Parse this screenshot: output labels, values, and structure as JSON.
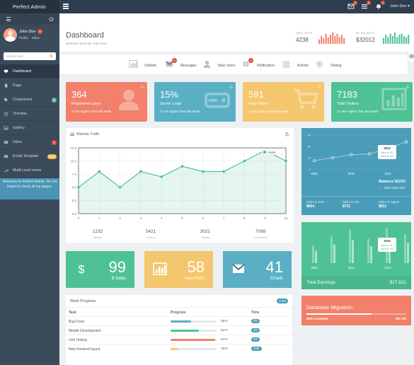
{
  "topbar": {
    "brand": "Perfect Admin",
    "badges": {
      "messages": "4",
      "tasks": "5",
      "notifications": "1"
    },
    "user": "John Doe"
  },
  "sidebar": {
    "profile": {
      "name": "John Doe",
      "badge": "4",
      "link_profile": "Profile",
      "link_inbox": "Inbox"
    },
    "search_placeholder": "search here...",
    "items": [
      {
        "label": "Dashboard",
        "icon": "monitor-icon",
        "active": true
      },
      {
        "label": "Page",
        "icon": "file-icon"
      },
      {
        "label": "Component",
        "icon": "tag-icon",
        "badge": "8",
        "badge_color": "#4ec294"
      },
      {
        "label": "Timeline",
        "icon": "clock-icon"
      },
      {
        "label": "Gallery",
        "icon": "image-icon"
      },
      {
        "label": "Inbox",
        "icon": "mail-icon",
        "badge": "4",
        "badge_color": "#e74c3c"
      },
      {
        "label": "Email Template",
        "icon": "envelope-icon",
        "badge": "NEW",
        "badge_color": "#f0b84d"
      },
      {
        "label": "Multi-Level menu",
        "icon": "wrench-icon"
      }
    ],
    "note": "Welcome to Perfect Admin. Do not forget to check all my pages."
  },
  "header": {
    "title": "Dashboard",
    "subtitle": "Welcome back Mr. John Doe",
    "stats": [
      {
        "label": "New visits",
        "value": "4238",
        "color": "#f2806b",
        "bars": [
          4,
          7,
          5,
          9,
          6,
          8,
          10,
          7,
          9,
          6,
          8,
          5
        ]
      },
      {
        "label": "My balance",
        "value": "$32012",
        "color": "#4ec294",
        "bars": [
          5,
          8,
          6,
          9,
          7,
          10,
          6,
          8,
          9,
          7,
          6,
          8
        ]
      }
    ]
  },
  "nav": [
    {
      "label": "Statistic",
      "icon": "bar-chart-icon"
    },
    {
      "label": "Messages",
      "icon": "envelope-icon",
      "badge": "5"
    },
    {
      "label": "New Users",
      "icon": "user-icon"
    },
    {
      "label": "Notification",
      "icon": "globe-icon",
      "badge": "7"
    },
    {
      "label": "Activity",
      "icon": "list-icon"
    },
    {
      "label": "Setting",
      "icon": "gear-icon"
    }
  ],
  "cards": [
    {
      "value": "364",
      "label": "Registered users",
      "sub": "5% Higher than last week",
      "color": "#f2806b",
      "icon": "user-icon"
    },
    {
      "value": "15%",
      "label": "Server Load",
      "sub": "1% Higher than last week",
      "color": "#5aafc4",
      "icon": "hdd-icon"
    },
    {
      "value": "591",
      "label": "New Orders",
      "sub": "5% Higher than last week",
      "color": "#f4c66d",
      "icon": "cart-icon"
    },
    {
      "value": "7183",
      "label": "Total Visitors",
      "sub": "75% Higher than last week",
      "color": "#4ec294",
      "icon": "bar-chart-icon"
    }
  ],
  "traffic": {
    "title": "Website Traffic",
    "stats": [
      {
        "value": "1232",
        "label": "Visitors"
      },
      {
        "value": "5421",
        "label": "Orders"
      },
      {
        "value": "3021",
        "label": "Tickets"
      },
      {
        "value": "7098",
        "label": "Customers"
      }
    ]
  },
  "chart_data": [
    {
      "type": "area",
      "x": [
        0,
        1,
        2,
        3,
        4,
        5,
        6,
        7,
        8,
        9,
        10
      ],
      "series": [
        {
          "name": "Visitor",
          "values": [
            5,
            8,
            5,
            8,
            7,
            9,
            8,
            8,
            10,
            12,
            10
          ],
          "color": "#4ec294"
        }
      ],
      "xlim": [
        0,
        10
      ],
      "ylim": [
        0,
        12.5
      ],
      "yticks": [
        "0.0",
        "2.5",
        "5.0",
        "7.5",
        "10.0",
        "12.5"
      ],
      "xticks": [
        "0",
        "1",
        "2",
        "3",
        "4",
        "5",
        "6",
        "7",
        "8",
        "9",
        "10"
      ],
      "grid": true,
      "legend": "top-right"
    },
    {
      "type": "line",
      "x": [
        2008,
        2009,
        2010,
        2011,
        2012,
        2013
      ],
      "values": [
        22,
        30,
        38,
        40,
        55,
        72
      ],
      "xticks": [
        "2008",
        "2010",
        "2012"
      ],
      "yticks": [
        "90",
        "60",
        "30",
        "0"
      ],
      "ylim": [
        0,
        90
      ],
      "tooltip": {
        "year": "2012",
        "item_a": "Item A: 50",
        "item_b": "Item B: 30"
      }
    },
    {
      "type": "bar",
      "x": [
        2008,
        2009,
        2010,
        2011,
        2012,
        2013
      ],
      "values": [
        40,
        60,
        75,
        55,
        80,
        65
      ],
      "xticks": [
        "2008",
        "2010",
        "2012"
      ],
      "tooltip": {
        "year": "2012",
        "item_a": "Item A: 50",
        "item_b": "Item B: 30"
      }
    }
  ],
  "balance": {
    "title": "Balance $3210",
    "total_sales": "Total Sales 867",
    "rows": [
      {
        "label": "Sales in June",
        "value": "$664"
      },
      {
        "label": "Sales in July",
        "value": "$731"
      },
      {
        "label": "Sales in August",
        "value": "$912"
      }
    ]
  },
  "earnings": {
    "label": "Total Earnings",
    "value": "$17,531"
  },
  "migration": {
    "title": "Database Migration",
    "complete": "65% Complete",
    "remaining": "5hr left",
    "progress": 0.65
  },
  "boxes": [
    {
      "number": "99",
      "label": "$ Sales",
      "color": "#4ec294",
      "icon": "dollar-icon"
    },
    {
      "number": "58",
      "label": "New Visits",
      "color": "#f4c66d",
      "icon": "bar-chart-icon"
    },
    {
      "number": "41",
      "label": "Emails",
      "color": "#5aafc4",
      "icon": "envelope-icon"
    }
  ],
  "work": {
    "title": "Work Progress",
    "badge": "4 left",
    "headers": [
      "Task",
      "Progress",
      "Time"
    ],
    "rows": [
      {
        "task": "Bug Fixes",
        "progress": 0.45,
        "pct": "45%",
        "time": "2hr",
        "color": "#5aafc4"
      },
      {
        "task": "Mobile Development",
        "progress": 0.61,
        "pct": "61%",
        "time": "1hr",
        "color": "#4ec294"
      },
      {
        "task": "Unit Testing",
        "progress": 0.97,
        "pct": "97%",
        "time": "5m",
        "color": "#f2806b"
      },
      {
        "task": "New frontend layout",
        "progress": 0.15,
        "pct": "15%",
        "time": "12hr",
        "color": "#f4c66d"
      }
    ]
  }
}
